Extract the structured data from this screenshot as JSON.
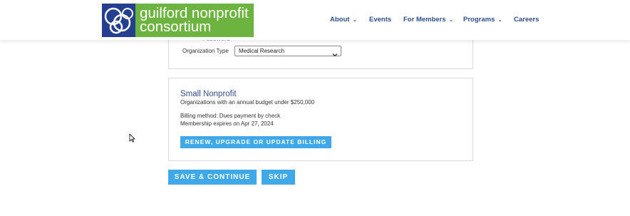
{
  "logo": {
    "line1": "guilford nonprofit",
    "line2": "consortium"
  },
  "nav": {
    "items": [
      {
        "label": "About",
        "has_dropdown": true
      },
      {
        "label": "Events",
        "has_dropdown": false
      },
      {
        "label": "For Members",
        "has_dropdown": true
      },
      {
        "label": "Programs",
        "has_dropdown": true
      },
      {
        "label": "Careers",
        "has_dropdown": false
      }
    ],
    "caret": "⌄"
  },
  "form": {
    "obscured_label": "Password",
    "org_type_label": "Organization Type",
    "org_type_value": "Medical Research"
  },
  "membership": {
    "plan_name": "Small Nonprofit",
    "plan_description": "Organizations with an annual budget under $250,000",
    "billing_method": "Billing method: Dues payment by check",
    "expires": "Membership expires on Apr 27, 2024",
    "renew_button": "RENEW, UPGRADE OR UPDATE BILLING"
  },
  "actions": {
    "save_continue": "SAVE & CONTINUE",
    "skip": "SKIP"
  },
  "colors": {
    "accent": "#3ea8e8",
    "nav_text": "#2e4f88",
    "logo_green": "#6cb33f",
    "logo_blue": "#243f8f"
  }
}
